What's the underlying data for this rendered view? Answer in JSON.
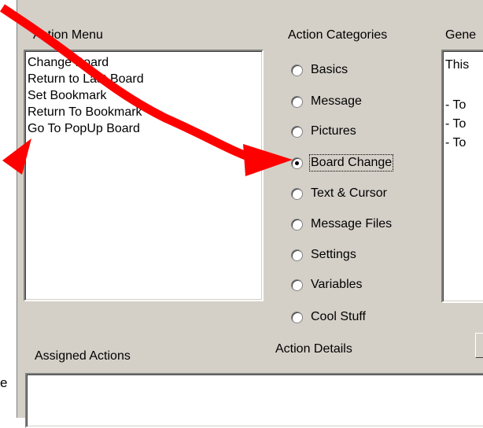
{
  "action_menu": {
    "label": "Action Menu",
    "items": [
      "Change Board",
      "Return to Last Board",
      "Set Bookmark",
      "Return To Bookmark",
      "Go To PopUp Board"
    ]
  },
  "action_categories": {
    "label": "Action Categories",
    "options": [
      {
        "label": "Basics",
        "selected": false
      },
      {
        "label": "Message",
        "selected": false
      },
      {
        "label": "Pictures",
        "selected": false
      },
      {
        "label": "Board Change",
        "selected": true
      },
      {
        "label": "Text & Cursor",
        "selected": false
      },
      {
        "label": "Message Files",
        "selected": false
      },
      {
        "label": "Settings",
        "selected": false
      },
      {
        "label": "Variables",
        "selected": false
      },
      {
        "label": "Cool Stuff",
        "selected": false
      }
    ]
  },
  "general": {
    "label": "Gene",
    "lines": [
      "This",
      "- To",
      "- To",
      "- To"
    ]
  },
  "assigned_actions": {
    "label": "Assigned Actions"
  },
  "action_details": {
    "label": "Action Details"
  },
  "edge_text": "e",
  "annotation": {
    "arrow_color": "#ff0000"
  }
}
